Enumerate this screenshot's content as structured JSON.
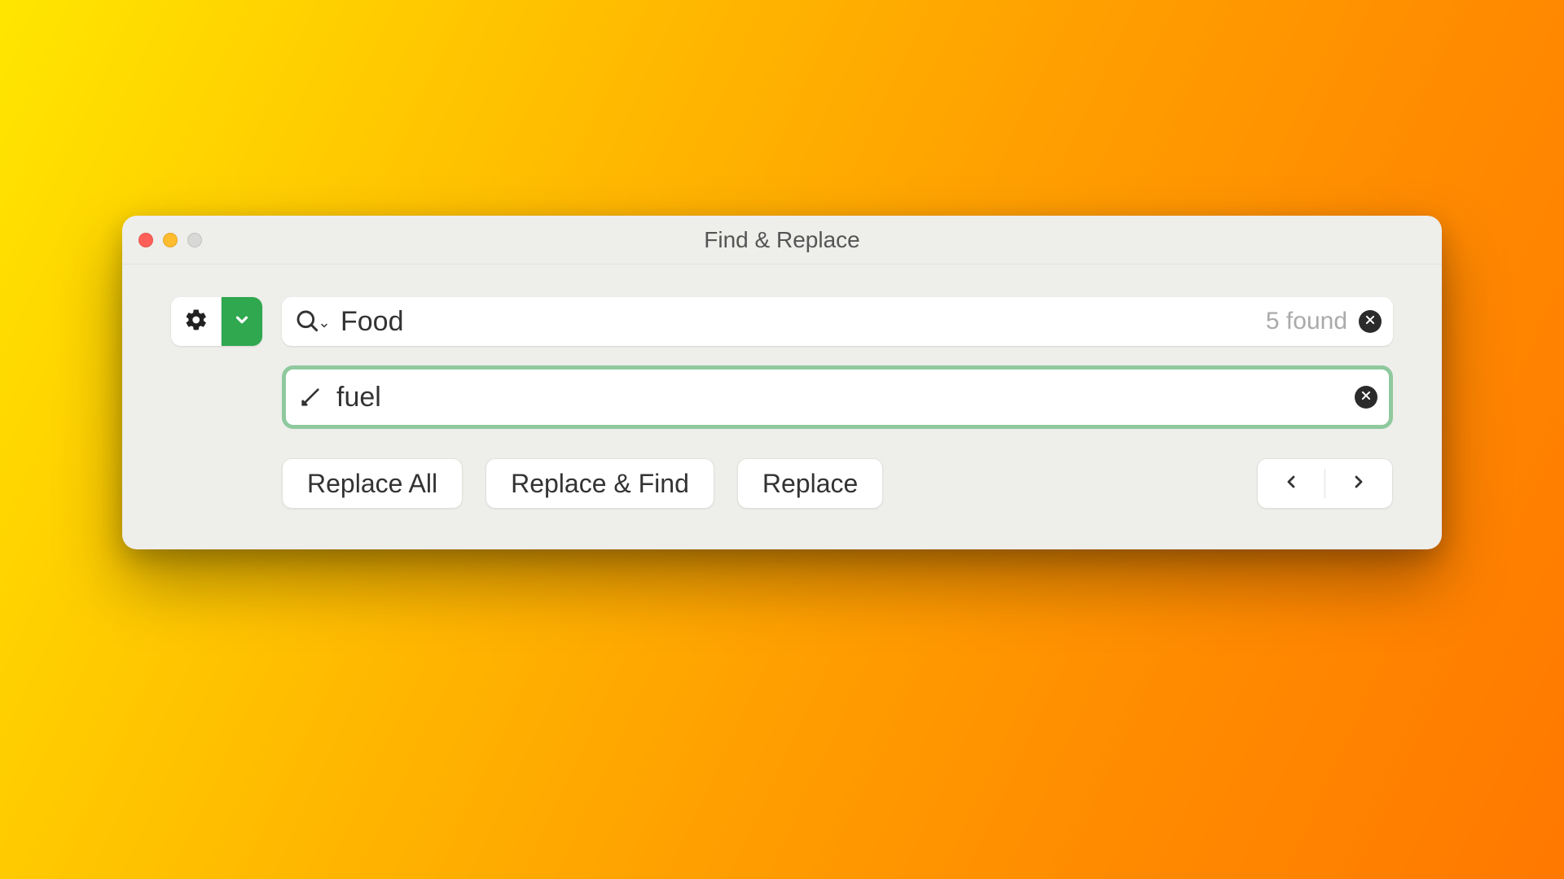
{
  "window": {
    "title": "Find & Replace"
  },
  "search": {
    "value": "Food",
    "found_text": "5 found"
  },
  "replace": {
    "value": "fuel"
  },
  "buttons": {
    "replace_all": "Replace All",
    "replace_and_find": "Replace & Find",
    "replace": "Replace"
  }
}
